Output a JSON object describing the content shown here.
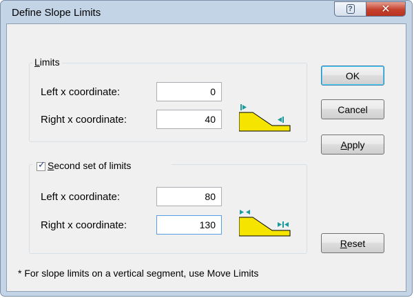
{
  "window": {
    "title": "Define Slope Limits",
    "help_glyph": "?",
    "close_glyph": "✕"
  },
  "limits": {
    "legend_rest": "imits",
    "legend_mnemonic": "L",
    "left_label": "Left x coordinate:",
    "left_value": "0",
    "right_label": "Right x coordinate:",
    "right_value": "40"
  },
  "second_limits": {
    "checked": true,
    "legend_mnemonic": "S",
    "legend_rest": "econd set of limits",
    "left_label": "Left x coordinate:",
    "left_value": "80",
    "right_label": "Right x coordinate:",
    "right_value": "130"
  },
  "buttons": {
    "ok": "OK",
    "cancel": "Cancel",
    "apply_mnemonic": "A",
    "apply_rest": "pply",
    "reset_mnemonic": "R",
    "reset_rest": "eset"
  },
  "note": "* For slope limits on a vertical segment, use Move Limits",
  "icons": {
    "help": "help-icon",
    "close": "close-icon",
    "slope_limits": "slope-limits-icon",
    "slope_limits_pair": "slope-limits-pair-icon"
  },
  "colors": {
    "slope_fill": "#f5e400",
    "limit_marker": "#1a9a9a",
    "close_button": "#c4412d"
  }
}
